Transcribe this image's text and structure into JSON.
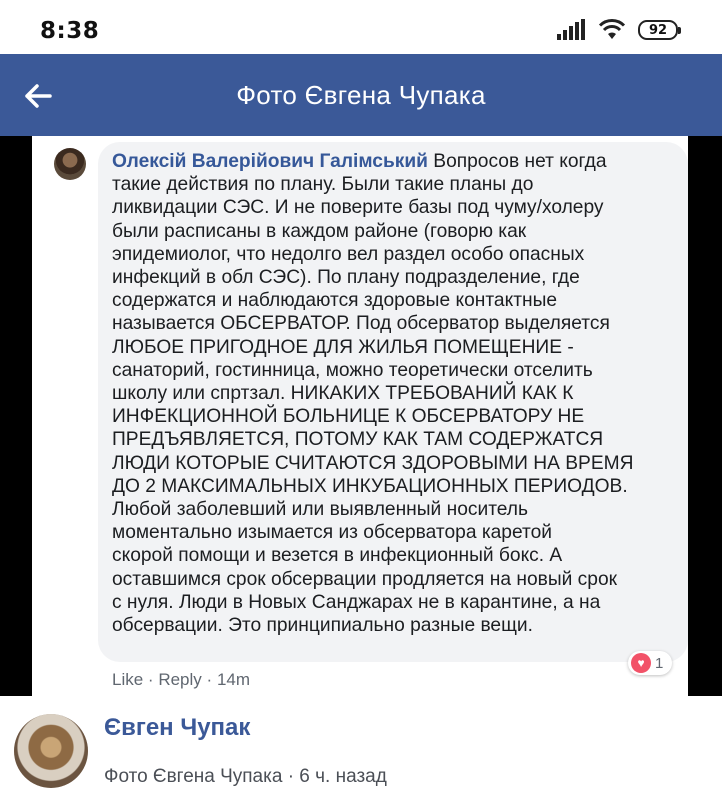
{
  "status_bar": {
    "time": "8:38",
    "battery": "92",
    "icons": [
      "signal-icon",
      "wifi-icon",
      "battery-icon"
    ]
  },
  "header": {
    "title": "Фото Євгена Чупака",
    "back_icon": "arrow-left-icon",
    "color": "#3b5998"
  },
  "comment": {
    "author": "Олексій Валерійович Галімський",
    "text": " Вопросов нет когда\nтакие действия по плану. Были такие планы до\nликвидации СЭС. И не поверите базы под чуму/холеру\nбыли расписаны в каждом районе (говорю как\nэпидемиолог, что недолго вел раздел особо опасных\nинфекций в обл СЭС). По плану подразделение, где\nсодержатся и наблюдаются здоровые контактные\nназывается ОБСЕРВАТОР. Под обсерватор выделяется\nЛЮБОЕ ПРИГОДНОЕ ДЛЯ ЖИЛЬЯ ПОМЕЩЕНИЕ -\nсанаторий, гостинница, можно теоретически отселить\nшколу или спртзал. НИКАКИХ ТРЕБОВАНИЙ КАК К\nИНФЕКЦИОННОЙ БОЛЬНИЦЕ К ОБСЕРВАТОРУ НЕ\nПРЕДЪЯВЛЯЕТСЯ, ПОТОМУ КАК ТАМ СОДЕРЖАТСЯ\nЛЮДИ КОТОРЫЕ СЧИТАЮТСЯ ЗДОРОВЫМИ НА ВРЕМЯ\nДО 2 МАКСИМАЛЬНЫХ ИНКУБАЦИОННЫХ ПЕРИОДОВ.\nЛюбой заболевший или выявленный носитель\nмоментально изымается из обсерватора каретой\nскорой помощи и везется в инфекционный бокс. А\nоставшимся срок обсервации продляется на новый срок\nс нуля. Люди в Новых Санджарах не в карантине, а на\nобсервации. Это принципиально разные вещи.",
    "like_label": "Like",
    "separator": "·",
    "reply_label": "Reply",
    "time": "14m",
    "reaction_count": "1",
    "reaction_icon": "heart-icon"
  },
  "footer": {
    "name": "Євген Чупак",
    "meta": "Фото Євгена Чупака · 6 ч. назад"
  }
}
